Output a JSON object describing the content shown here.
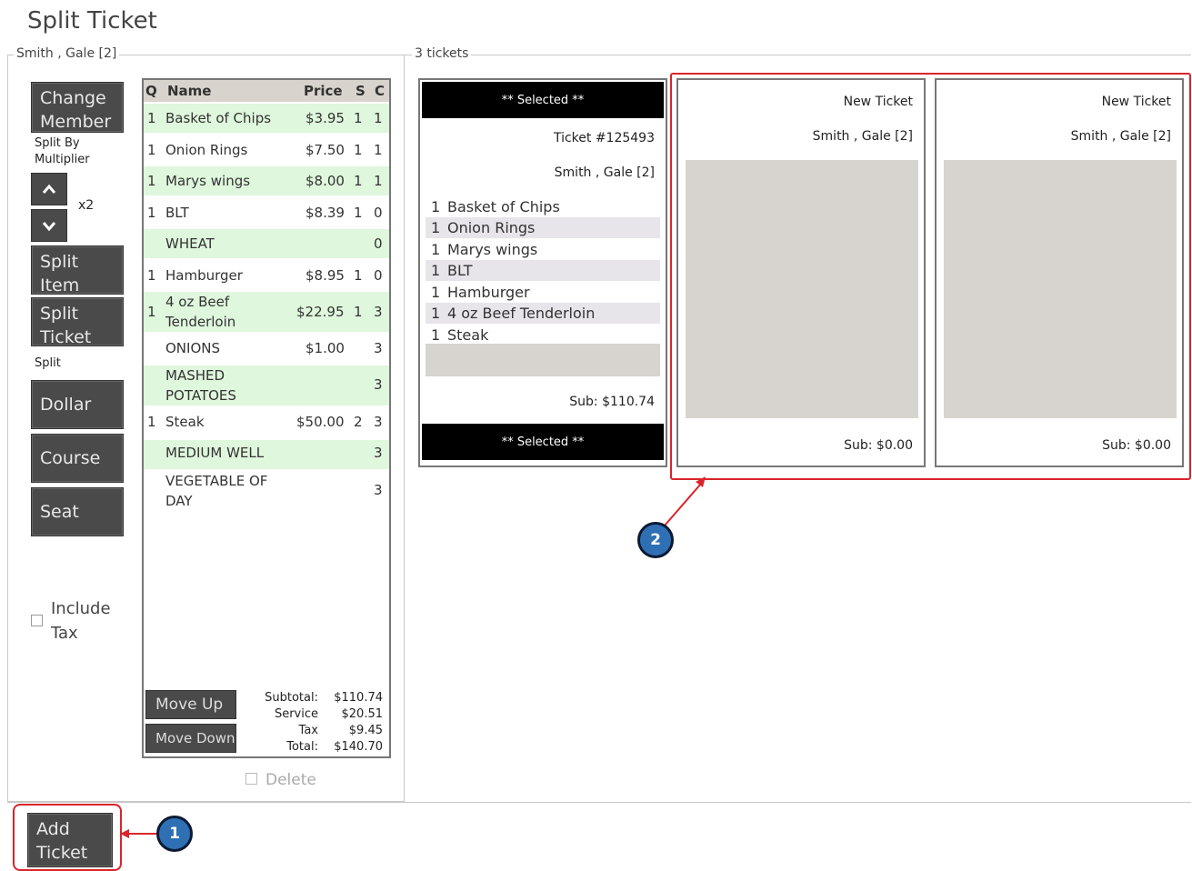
{
  "title": "Split Ticket",
  "left_legend": "Smith , Gale [2]",
  "right_legend": "3 tickets",
  "buttons": {
    "change_member": "Change Member",
    "split_by_multiplier": "Split By Multiplier",
    "multiplier": "x2",
    "split_item": "Split Item",
    "split_ticket": "Split Ticket",
    "split_label": "Split",
    "dollar": "Dollar",
    "course": "Course",
    "seat": "Seat",
    "include_tax": "Include Tax",
    "move_up": "Move Up",
    "move_down": "Move Down",
    "delete": "Delete",
    "add_ticket": "Add Ticket"
  },
  "items_table": {
    "headers": {
      "q": "Q",
      "name": "Name",
      "price": "Price",
      "s": "S",
      "c": "C"
    },
    "rows": [
      {
        "q": "1",
        "name": "Basket of Chips",
        "price": "$3.95",
        "s": "1",
        "c": "1"
      },
      {
        "q": "1",
        "name": "Onion Rings",
        "price": "$7.50",
        "s": "1",
        "c": "1"
      },
      {
        "q": "1",
        "name": "Marys wings",
        "price": "$8.00",
        "s": "1",
        "c": "1"
      },
      {
        "q": "1",
        "name": "BLT",
        "price": "$8.39",
        "s": "1",
        "c": "0"
      },
      {
        "q": "",
        "name": "WHEAT",
        "price": "",
        "s": "",
        "c": "0"
      },
      {
        "q": "1",
        "name": "Hamburger",
        "price": "$8.95",
        "s": "1",
        "c": "0"
      },
      {
        "q": "1",
        "name": "4 oz Beef Tenderloin",
        "price": "$22.95",
        "s": "1",
        "c": "3"
      },
      {
        "q": "",
        "name": "ONIONS",
        "price": "$1.00",
        "s": "",
        "c": "3"
      },
      {
        "q": "",
        "name": "MASHED POTATOES",
        "price": "",
        "s": "",
        "c": "3"
      },
      {
        "q": "1",
        "name": "Steak",
        "price": "$50.00",
        "s": "2",
        "c": "3"
      },
      {
        "q": "",
        "name": "MEDIUM WELL",
        "price": "",
        "s": "",
        "c": "3"
      },
      {
        "q": "",
        "name": "VEGETABLE OF DAY",
        "price": "",
        "s": "",
        "c": "3"
      }
    ],
    "totals": {
      "subtotal_label": "Subtotal:",
      "subtotal": "$110.74",
      "service_label": "Service",
      "service": "$20.51",
      "tax_label": "Tax",
      "tax": "$9.45",
      "total_label": "Total:",
      "total": "$140.70"
    }
  },
  "tickets": [
    {
      "selected_label": "** Selected **",
      "ticket_no": "Ticket #125493",
      "member": "Smith , Gale [2]",
      "lines": [
        {
          "q": "1",
          "name": "Basket of Chips"
        },
        {
          "q": "1",
          "name": "Onion Rings"
        },
        {
          "q": "1",
          "name": "Marys wings"
        },
        {
          "q": "1",
          "name": "BLT"
        },
        {
          "q": "1",
          "name": "Hamburger"
        },
        {
          "q": "1",
          "name": "4 oz Beef Tenderloin"
        },
        {
          "q": "1",
          "name": "Steak"
        }
      ],
      "sub": "Sub: $110.74"
    },
    {
      "header": "New Ticket",
      "member": "Smith , Gale [2]",
      "sub": "Sub: $0.00"
    },
    {
      "header": "New Ticket",
      "member": "Smith , Gale [2]",
      "sub": "Sub: $0.00"
    }
  ],
  "callouts": [
    "1",
    "2"
  ],
  "colors": {
    "highlight": "#d9252b",
    "callout": "#2f6fb4",
    "row_green": "#dff7dd"
  }
}
